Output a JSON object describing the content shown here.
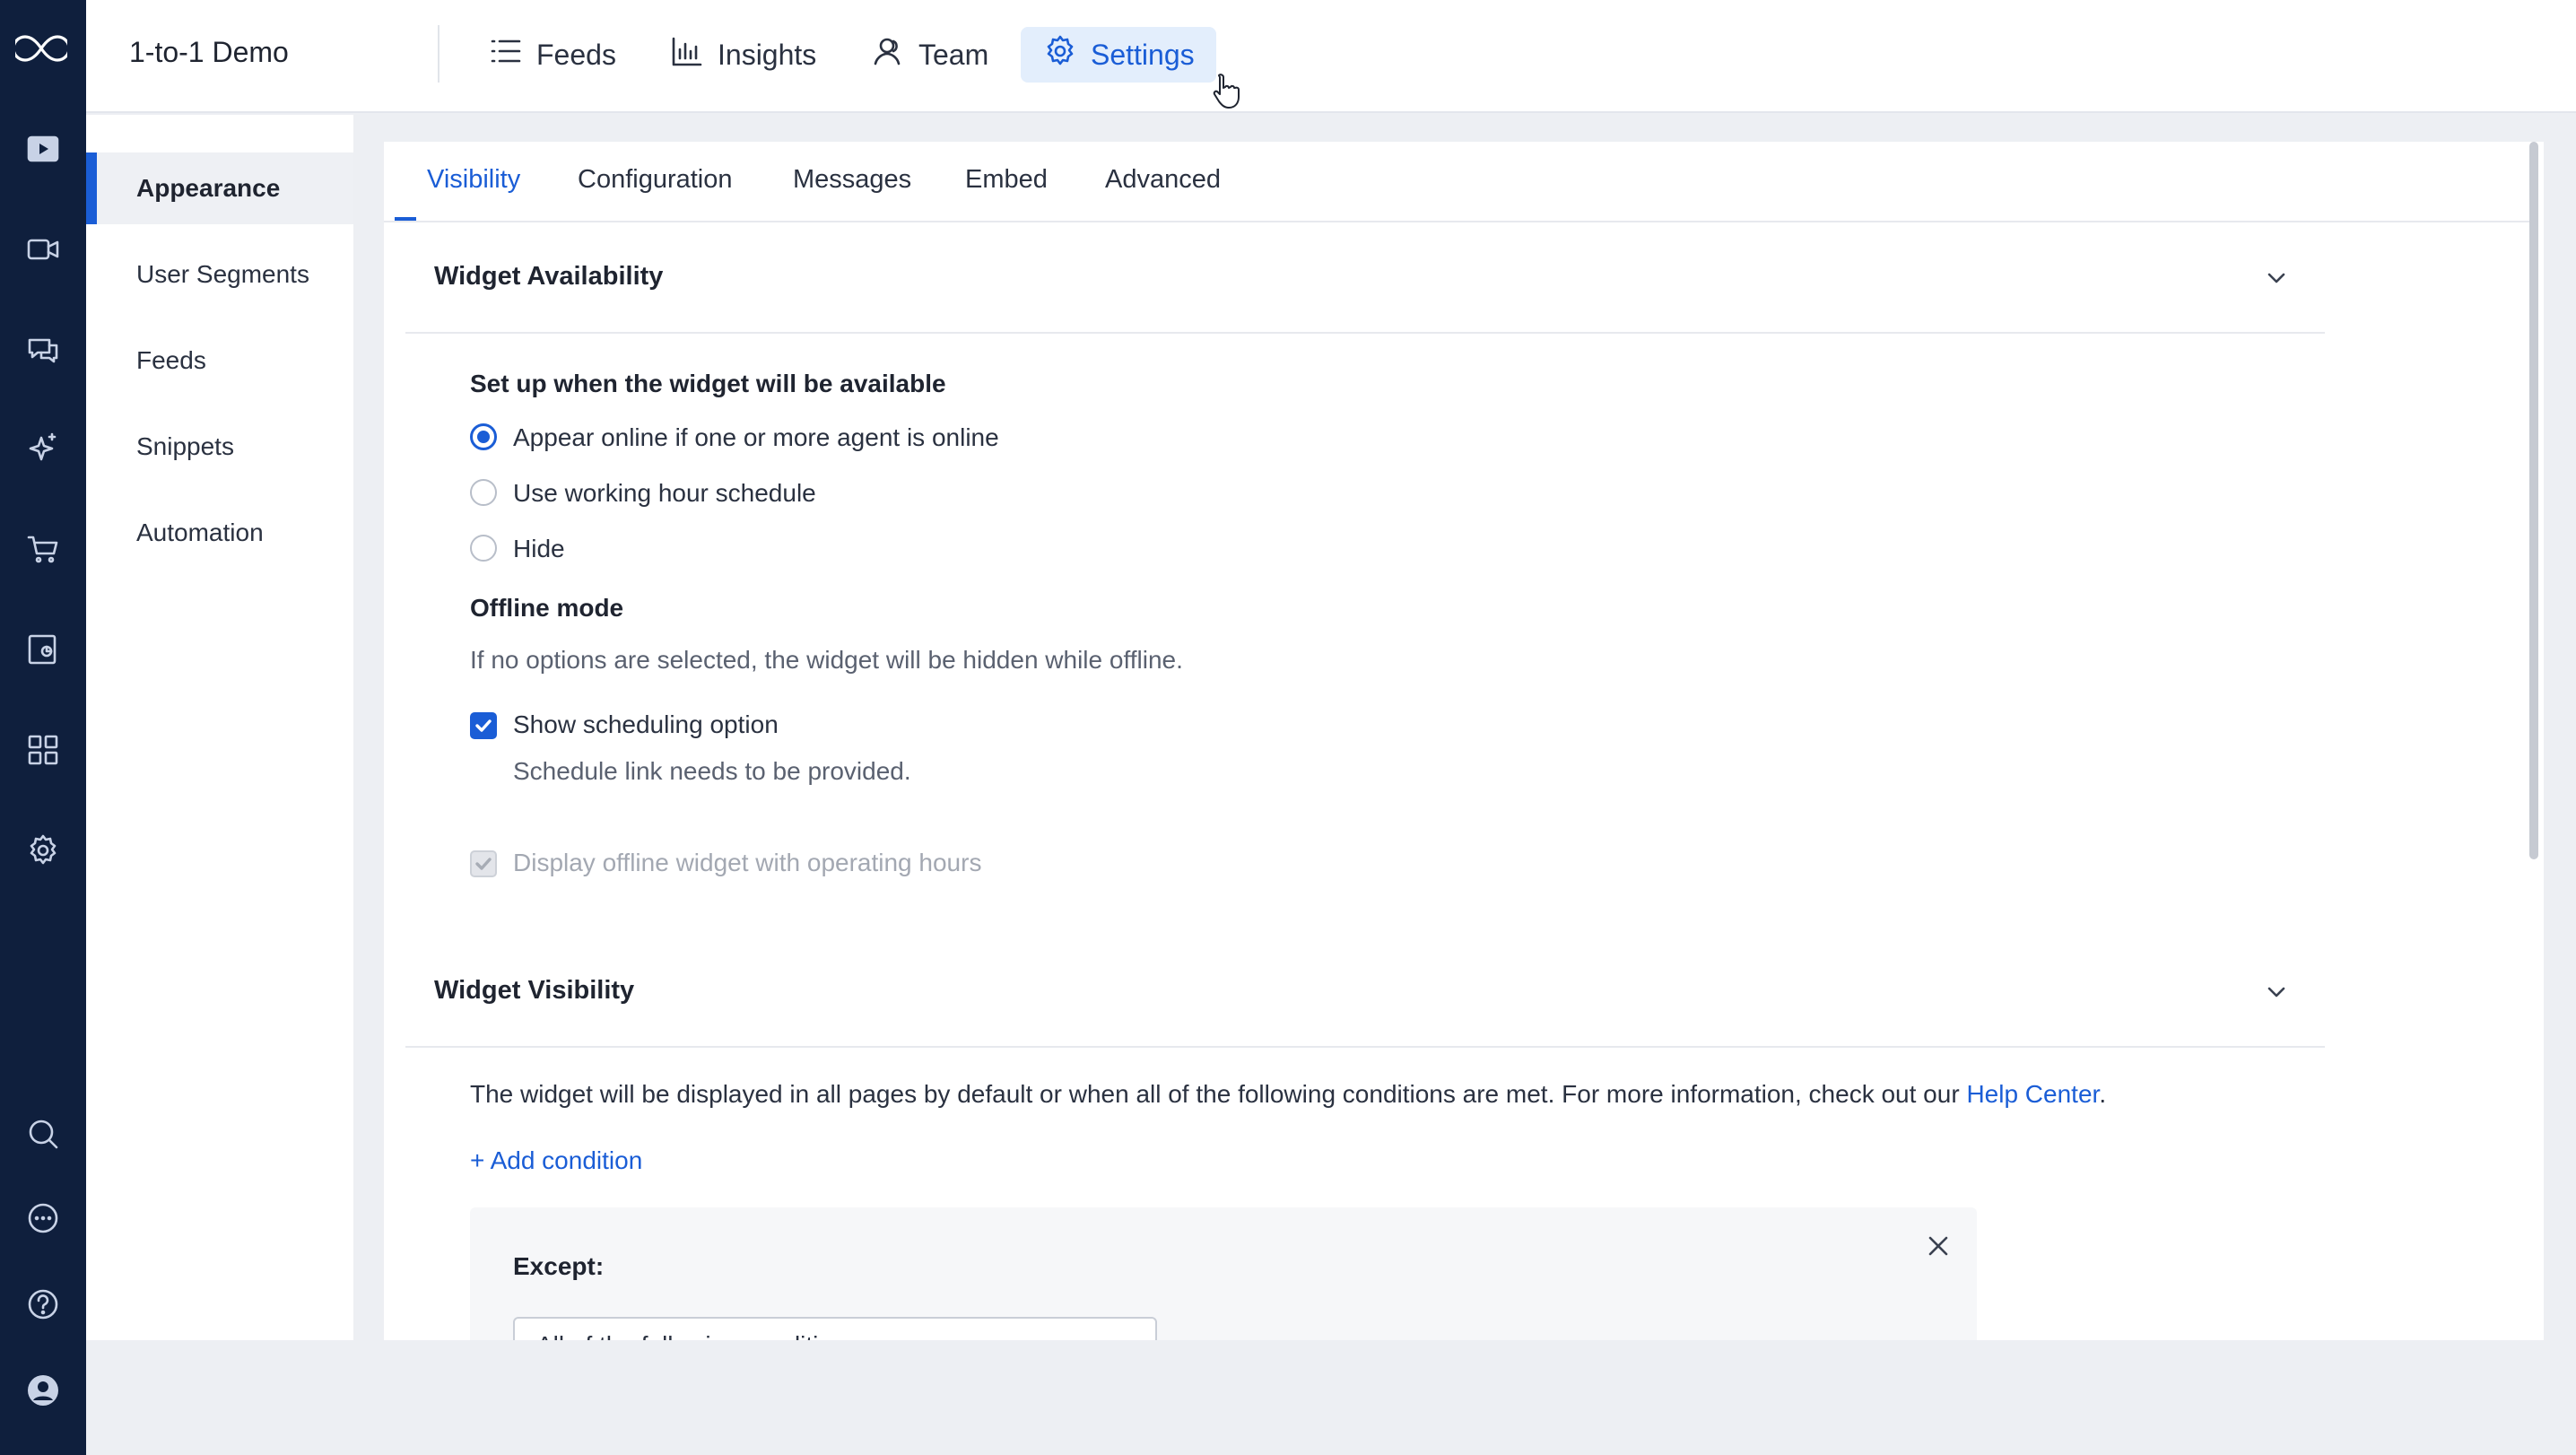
{
  "app": {
    "title": "1-to-1 Demo"
  },
  "topnav": [
    {
      "label": "Feeds",
      "icon": "list-icon"
    },
    {
      "label": "Insights",
      "icon": "bar-chart-icon"
    },
    {
      "label": "Team",
      "icon": "team-icon"
    },
    {
      "label": "Settings",
      "icon": "gear-icon",
      "active": true
    }
  ],
  "sidebar": {
    "items": [
      {
        "label": "Appearance",
        "active": true
      },
      {
        "label": "User Segments"
      },
      {
        "label": "Feeds"
      },
      {
        "label": "Snippets"
      },
      {
        "label": "Automation"
      }
    ]
  },
  "rail": {
    "icons": [
      "logo-icon",
      "play-icon",
      "video-icon",
      "chat-icon",
      "sparkle-icon",
      "cart-icon",
      "report-icon",
      "grid-icon",
      "gear-icon",
      "search-icon",
      "message-icon",
      "help-icon",
      "avatar-icon"
    ]
  },
  "tabs": [
    {
      "label": "Visibility",
      "active": true
    },
    {
      "label": "Configuration"
    },
    {
      "label": "Messages"
    },
    {
      "label": "Embed"
    },
    {
      "label": "Advanced"
    }
  ],
  "availability": {
    "title": "Widget Availability",
    "question": "Set up when the widget will be available",
    "options": [
      {
        "label": "Appear online if one or more agent is online",
        "selected": true
      },
      {
        "label": "Use working hour schedule",
        "selected": false
      },
      {
        "label": "Hide",
        "selected": false
      }
    ],
    "offline_title": "Offline mode",
    "offline_desc": "If no options are selected, the widget will be hidden while offline.",
    "scheduling_label": "Show scheduling option",
    "scheduling_checked": true,
    "scheduling_hint": "Schedule link needs to be provided.",
    "operating_label": "Display offline widget with operating hours",
    "operating_checked": true,
    "operating_disabled": true
  },
  "visibility": {
    "title": "Widget Visibility",
    "description": "The widget will be displayed in all pages by default or when all of the following conditions are met. For more information, check out our",
    "help_link": "Help Center",
    "period": ".",
    "add_condition": "+ Add condition",
    "except_label": "Except:",
    "select_value": "All of the following conditions"
  },
  "colors": {
    "accent": "#1a5dd6",
    "rail": "#0f1f3d"
  }
}
